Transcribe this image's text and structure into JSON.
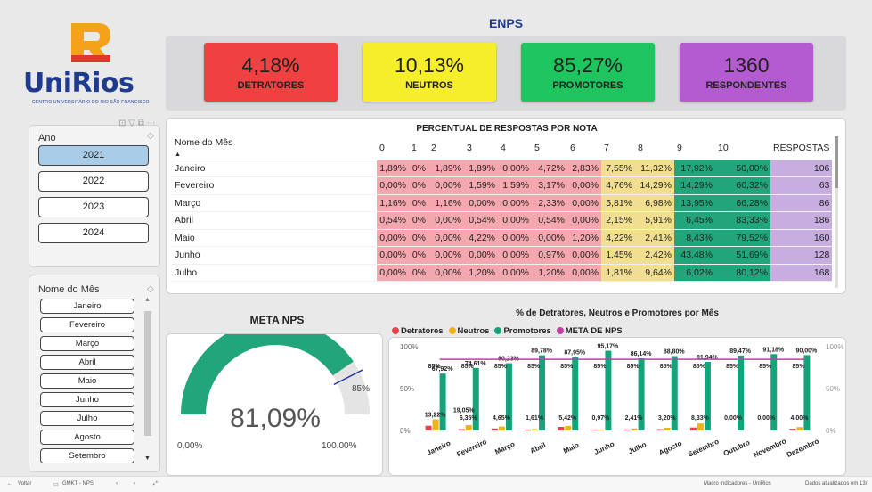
{
  "brand": {
    "name": "UniRios",
    "subtitle": "CENTRO UNIVERSITÁRIO DO RIO SÃO FRANCISCO",
    "mark": "R"
  },
  "page_title": "ENPS",
  "kpis": [
    {
      "value": "4,18%",
      "label": "DETRATORES",
      "color": "#ef4141"
    },
    {
      "value": "10,13%",
      "label": "NEUTROS",
      "color": "#f6ee2a"
    },
    {
      "value": "85,27%",
      "label": "PROMOTORES",
      "color": "#1ec45e"
    },
    {
      "value": "1360",
      "label": "RESPONDENTES",
      "color": "#b55bd1"
    }
  ],
  "year_slicer": {
    "title": "Ano",
    "options": [
      "2021",
      "2022",
      "2023",
      "2024"
    ],
    "selected": "2021"
  },
  "month_slicer": {
    "title": "Nome do Mês",
    "options": [
      "Janeiro",
      "Fevereiro",
      "Março",
      "Abril",
      "Maio",
      "Junho",
      "Julho",
      "Agosto",
      "Setembro"
    ]
  },
  "table": {
    "title": "PERCENTUAL DE RESPOSTAS POR NOTA",
    "headers": [
      "Nome do Mês",
      "0",
      "1",
      "2",
      "3",
      "4",
      "5",
      "6",
      "7",
      "8",
      "9",
      "10",
      "RESPOSTAS"
    ],
    "rows": [
      [
        "Janeiro",
        "1,89%",
        "0%",
        "1,89%",
        "1,89%",
        "0,00%",
        "4,72%",
        "2,83%",
        "7,55%",
        "11,32%",
        "17,92%",
        "50,00%",
        "106"
      ],
      [
        "Fevereiro",
        "0,00%",
        "0%",
        "0,00%",
        "1,59%",
        "1,59%",
        "3,17%",
        "0,00%",
        "4,76%",
        "14,29%",
        "14,29%",
        "60,32%",
        "63"
      ],
      [
        "Março",
        "1,16%",
        "0%",
        "1,16%",
        "0,00%",
        "0,00%",
        "2,33%",
        "0,00%",
        "5,81%",
        "6,98%",
        "13,95%",
        "66,28%",
        "86"
      ],
      [
        "Abril",
        "0,54%",
        "0%",
        "0,00%",
        "0,54%",
        "0,00%",
        "0,54%",
        "0,00%",
        "2,15%",
        "5,91%",
        "6,45%",
        "83,33%",
        "186"
      ],
      [
        "Maio",
        "0,00%",
        "0%",
        "0,00%",
        "4,22%",
        "0,00%",
        "0,00%",
        "1,20%",
        "4,22%",
        "2,41%",
        "8,43%",
        "79,52%",
        "160"
      ],
      [
        "Junho",
        "0,00%",
        "0%",
        "0,00%",
        "0,00%",
        "0,00%",
        "0,97%",
        "0,00%",
        "1,45%",
        "2,42%",
        "43,48%",
        "51,69%",
        "128"
      ],
      [
        "Julho",
        "0,00%",
        "0%",
        "0,00%",
        "1,20%",
        "0,00%",
        "1,20%",
        "0,00%",
        "1,81%",
        "9,64%",
        "6,02%",
        "80,12%",
        "168"
      ]
    ]
  },
  "gauge": {
    "title": "META NPS",
    "value": 81.09,
    "value_label": "81,09%",
    "min_label": "0,00%",
    "max_label": "100,00%",
    "target": 85,
    "target_label": "85%",
    "color": "#22a57a"
  },
  "bar_chart": {
    "title": "% de Detratores, Neutros e Promotores por Mês",
    "legend": [
      {
        "name": "Detratores",
        "color": "#e8424e"
      },
      {
        "name": "Neutros",
        "color": "#f0b21a"
      },
      {
        "name": "Promotores",
        "color": "#14a37b"
      },
      {
        "name": "META DE NPS",
        "color": "#c33fa3"
      }
    ]
  },
  "chart_data": {
    "type": "bar",
    "categories": [
      "Janeiro",
      "Fevereiro",
      "Março",
      "Abril",
      "Maio",
      "Junho",
      "Julho",
      "Agosto",
      "Setembro",
      "Outubro",
      "Novembro",
      "Dezembro"
    ],
    "series": [
      {
        "name": "Detratores",
        "values": [
          5.66,
          1.59,
          2.33,
          1.08,
          4.22,
          0.97,
          1.2,
          1.5,
          3.5,
          0,
          0,
          2
        ]
      },
      {
        "name": "Neutros",
        "values": [
          13.22,
          6.35,
          4.65,
          1.61,
          5.42,
          0.97,
          2.41,
          3.2,
          8.33,
          0,
          0,
          4
        ]
      },
      {
        "name": "Promotores",
        "values": [
          67.92,
          74.61,
          80.23,
          89.78,
          87.95,
          95.17,
          86.14,
          88.8,
          81.94,
          89.47,
          91.18,
          90
        ]
      },
      {
        "name": "META DE NPS",
        "values": [
          85,
          85,
          85,
          85,
          85,
          85,
          85,
          85,
          85,
          85,
          85,
          85
        ]
      }
    ],
    "neutros_labels": [
      "13,22%",
      "6,35%",
      "4,65%",
      "1,61%",
      "5,42%",
      "0,97%",
      "2,41%",
      "3,20%",
      "8,33%",
      "0,00%",
      "0,00%",
      "4,00%"
    ],
    "promotores_labels": [
      "67,92%",
      "74,61%",
      "80,23%",
      "89,78%",
      "87,95%",
      "95,17%",
      "86,14%",
      "88,80%",
      "81,94%",
      "89,47%",
      "91,18%",
      "90,00%"
    ],
    "extra_labels": [
      {
        "index": 1,
        "text": "19,05%"
      }
    ],
    "meta_label": "85%",
    "yticks": [
      "0%",
      "50%",
      "100%"
    ],
    "ylim": [
      0,
      100
    ]
  },
  "taskbar": {
    "back": "Voltar",
    "tab": "GMKT - NPS",
    "right_text": "Macro Indicadores - UniRios",
    "updated": "Dados atualizados em 13/"
  }
}
